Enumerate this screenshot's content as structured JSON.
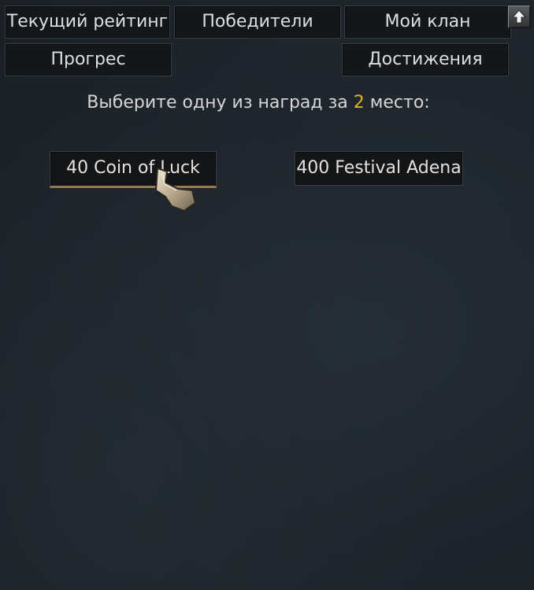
{
  "tabs": {
    "current_rating": "Текущий рейтинг",
    "winners": "Победители",
    "my_clan": "Мой клан",
    "progress": "Прогрес",
    "achievements": "Достижения"
  },
  "prompt": {
    "before": "Выберите одну из наград за ",
    "place": "2",
    "after": " место:"
  },
  "rewards": [
    {
      "label": "40 Coin of Luck"
    },
    {
      "label": "400 Festival Adena"
    }
  ],
  "icons": {
    "scroll_up": "arrow-up-icon",
    "cursor": "hand-pointer-icon"
  },
  "colors": {
    "place_highlight": "#e3b523",
    "selected_underline": "#9a7a55"
  }
}
